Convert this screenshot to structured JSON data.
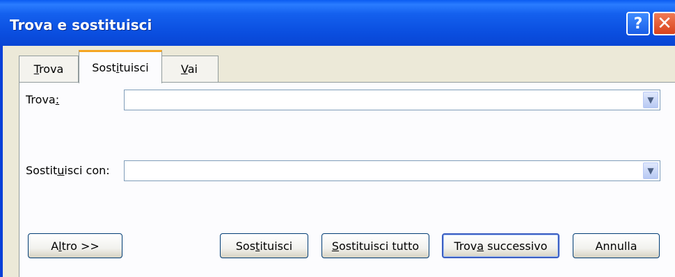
{
  "window": {
    "title": "Trova e sostituisci",
    "help_glyph": "?",
    "close_glyph": "✕"
  },
  "tabs": [
    {
      "prefix": "",
      "accel": "T",
      "suffix": "rova",
      "active": false
    },
    {
      "prefix": "Sost",
      "accel": "i",
      "suffix": "tuisci",
      "active": true
    },
    {
      "prefix": "",
      "accel": "V",
      "suffix": "ai",
      "active": false
    }
  ],
  "find": {
    "label_prefix": "Trova",
    "label_accel": ":",
    "value": ""
  },
  "replace": {
    "label_prefix": "Sostit",
    "label_accel": "u",
    "label_suffix": "isci con:",
    "value": ""
  },
  "buttons": {
    "more": {
      "prefix": "A",
      "accel": "l",
      "suffix": "tro >>"
    },
    "replace": {
      "prefix": "Sos",
      "accel": "t",
      "suffix": "ituisci"
    },
    "replace_all": {
      "prefix": "",
      "accel": "S",
      "suffix": "ostituisci tutto"
    },
    "find_next": {
      "prefix": "Trov",
      "accel": "a",
      "suffix": " successivo"
    },
    "cancel": {
      "label": "Annulla"
    }
  },
  "icons": {
    "dropdown_arrow": "▼"
  }
}
